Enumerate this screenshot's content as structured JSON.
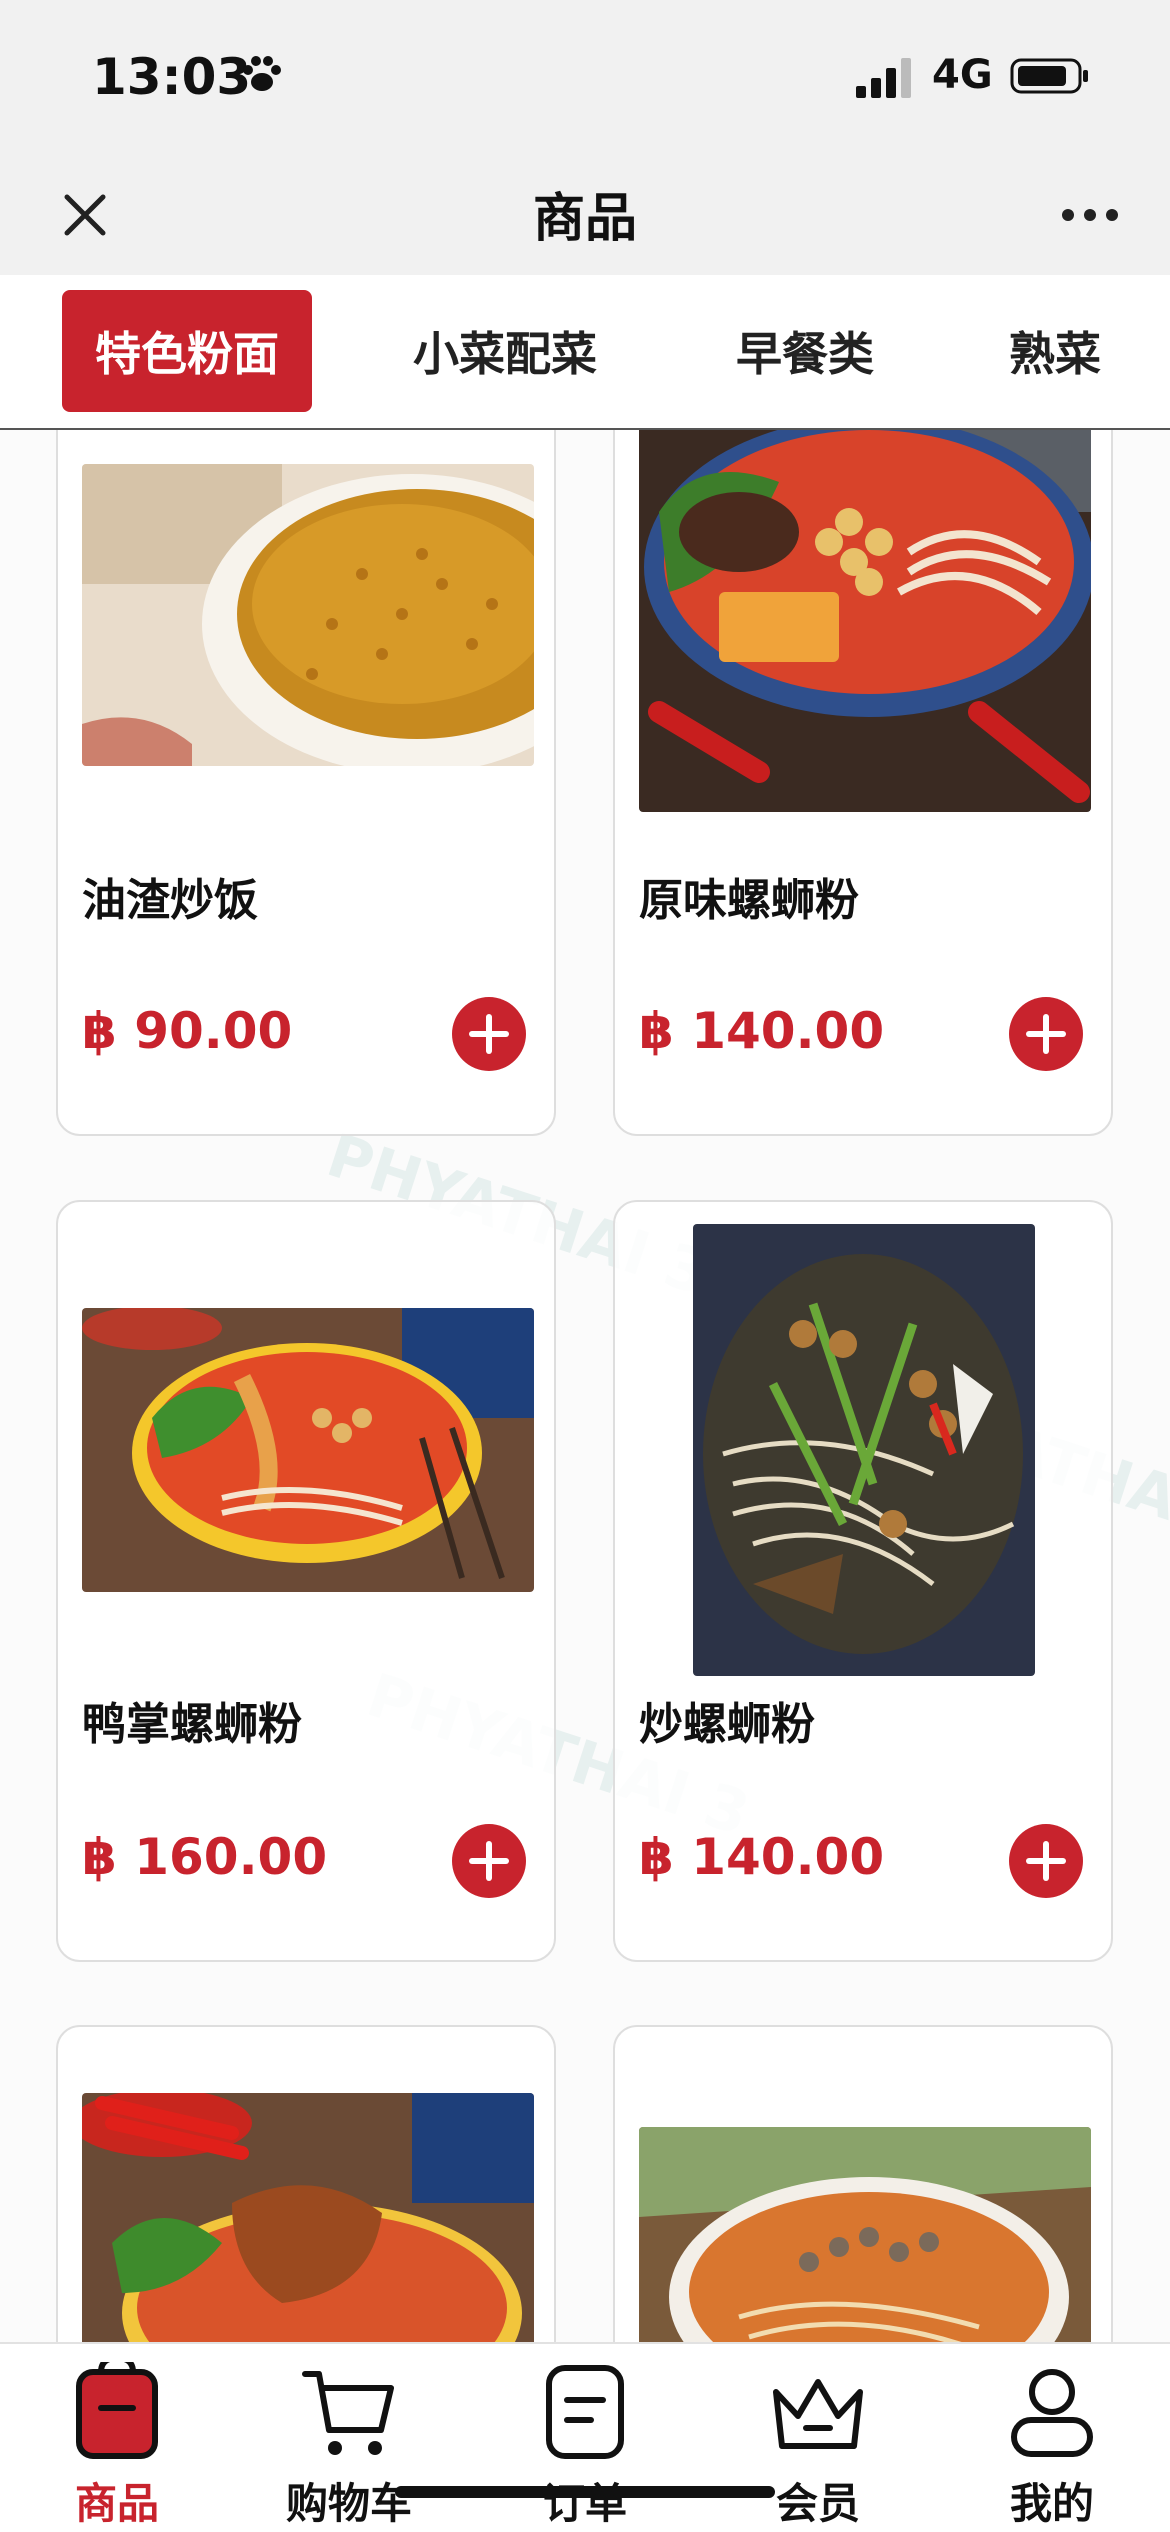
{
  "status": {
    "time": "13:03",
    "network": "4G"
  },
  "nav": {
    "title": "商品"
  },
  "categories": [
    {
      "label": "特色粉面",
      "active": true
    },
    {
      "label": "小菜配菜",
      "active": false
    },
    {
      "label": "早餐类",
      "active": false
    },
    {
      "label": "熟菜",
      "active": false
    }
  ],
  "products": [
    {
      "name": "油渣炒饭",
      "price": "฿ 90.00"
    },
    {
      "name": "原味螺蛳粉",
      "price": "฿ 140.00"
    },
    {
      "name": "鸭掌螺蛳粉",
      "price": "฿ 160.00"
    },
    {
      "name": "炒螺蛳粉",
      "price": "฿ 140.00"
    },
    {
      "name": "",
      "price": ""
    },
    {
      "name": "",
      "price": ""
    }
  ],
  "watermark": "PHYATHAI 3",
  "tabbar": [
    {
      "label": "商品",
      "icon": "goods-icon",
      "active": true
    },
    {
      "label": "购物车",
      "icon": "cart-icon",
      "active": false
    },
    {
      "label": "订单",
      "icon": "order-icon",
      "active": false
    },
    {
      "label": "会员",
      "icon": "crown-icon",
      "active": false
    },
    {
      "label": "我的",
      "icon": "user-icon",
      "active": false
    }
  ],
  "colors": {
    "accent": "#c8232d",
    "text": "#111111",
    "bg": "#fbfbfb"
  }
}
